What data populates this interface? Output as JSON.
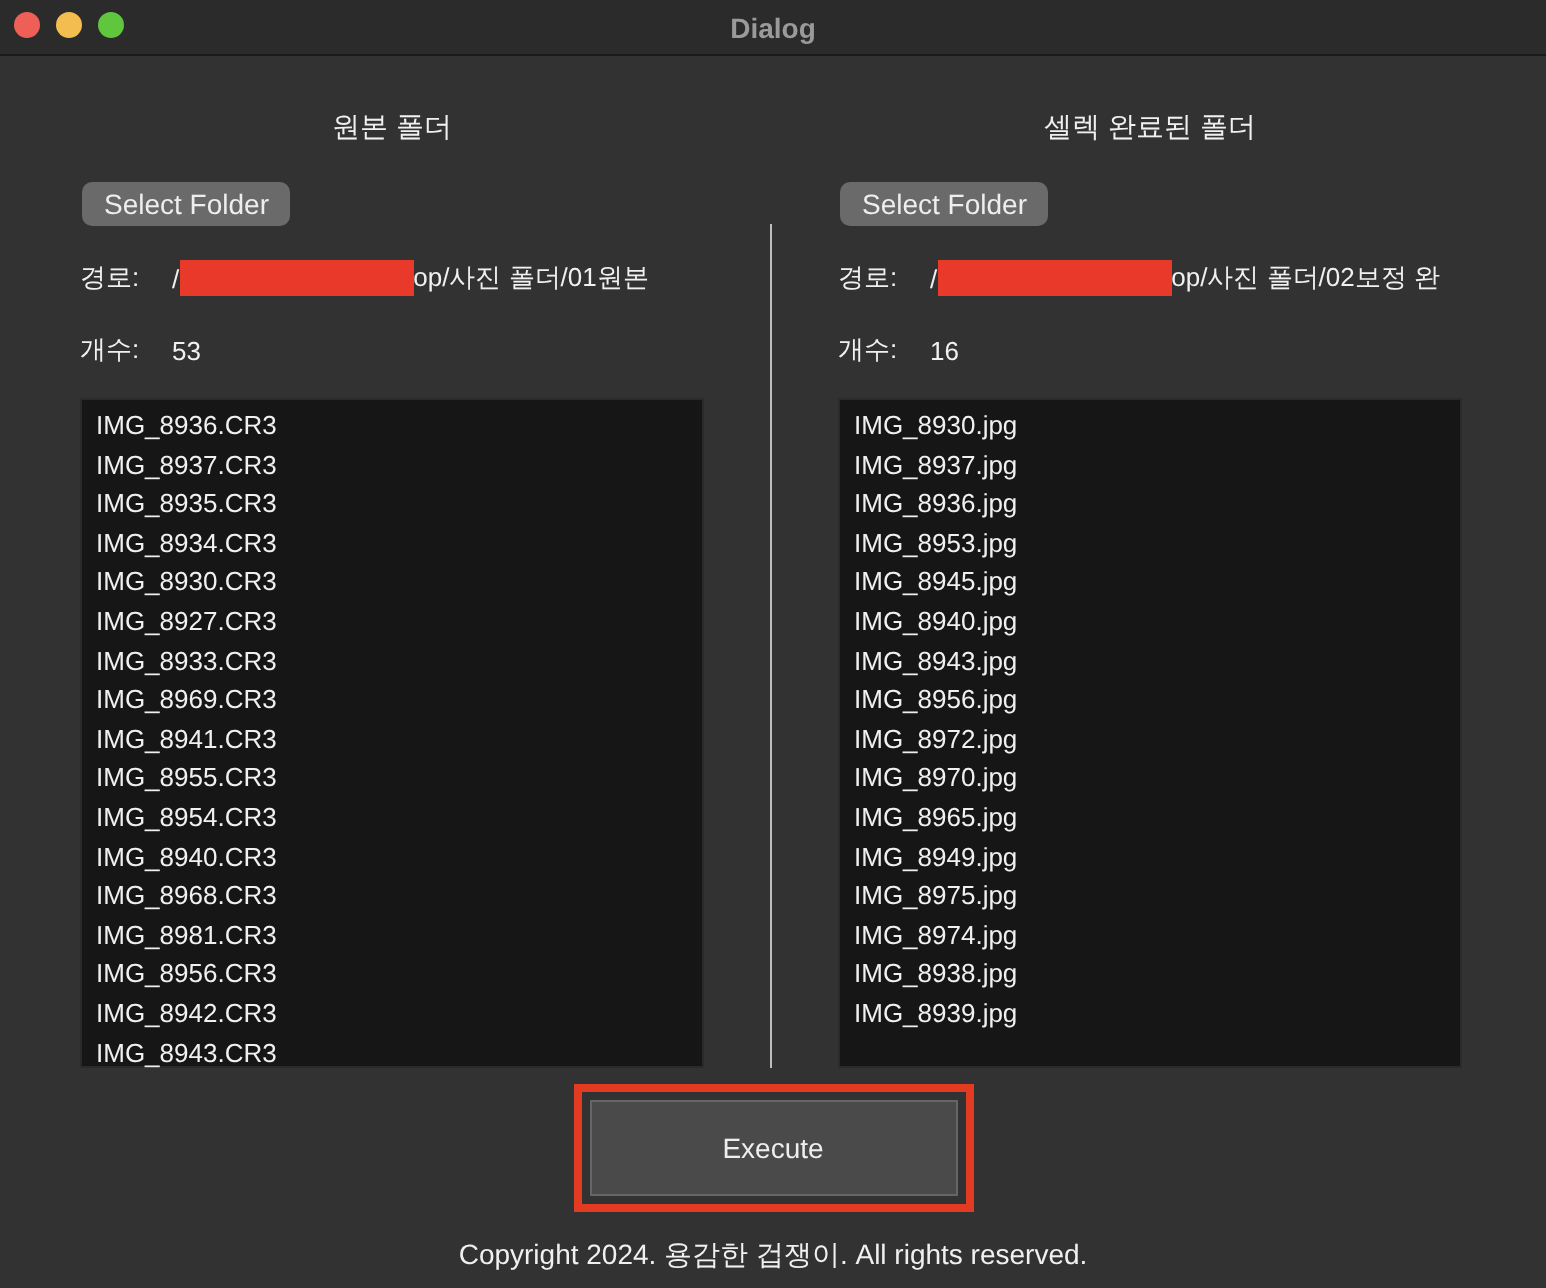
{
  "window": {
    "title": "Dialog"
  },
  "panels": [
    {
      "heading": "원본 폴더",
      "button": "Select Folder",
      "path_label": "경로:",
      "path_prefix": "/",
      "path_redacted": true,
      "path_suffix": "op/사진 폴더/01원본",
      "count_label": "개수:",
      "count": "53",
      "files": [
        "IMG_8936.CR3",
        "IMG_8937.CR3",
        "IMG_8935.CR3",
        "IMG_8934.CR3",
        "IMG_8930.CR3",
        "IMG_8927.CR3",
        "IMG_8933.CR3",
        "IMG_8969.CR3",
        "IMG_8941.CR3",
        "IMG_8955.CR3",
        "IMG_8954.CR3",
        "IMG_8940.CR3",
        "IMG_8968.CR3",
        "IMG_8981.CR3",
        "IMG_8956.CR3",
        "IMG_8942.CR3",
        "IMG_8943.CR3"
      ]
    },
    {
      "heading": "셀렉 완료된 폴더",
      "button": "Select Folder",
      "path_label": "경로:",
      "path_prefix": "/",
      "path_redacted": true,
      "path_suffix": "op/사진 폴더/02보정 완",
      "count_label": "개수:",
      "count": "16",
      "files": [
        "IMG_8930.jpg",
        "IMG_8937.jpg",
        "IMG_8936.jpg",
        "IMG_8953.jpg",
        "IMG_8945.jpg",
        "IMG_8940.jpg",
        "IMG_8943.jpg",
        "IMG_8956.jpg",
        "IMG_8972.jpg",
        "IMG_8970.jpg",
        "IMG_8965.jpg",
        "IMG_8949.jpg",
        "IMG_8975.jpg",
        "IMG_8974.jpg",
        "IMG_8938.jpg",
        "IMG_8939.jpg"
      ]
    }
  ],
  "execute": {
    "label": "Execute",
    "highlighted": true
  },
  "footer": "Copyright 2024. 용감한 겁쟁이. All rights reserved."
}
